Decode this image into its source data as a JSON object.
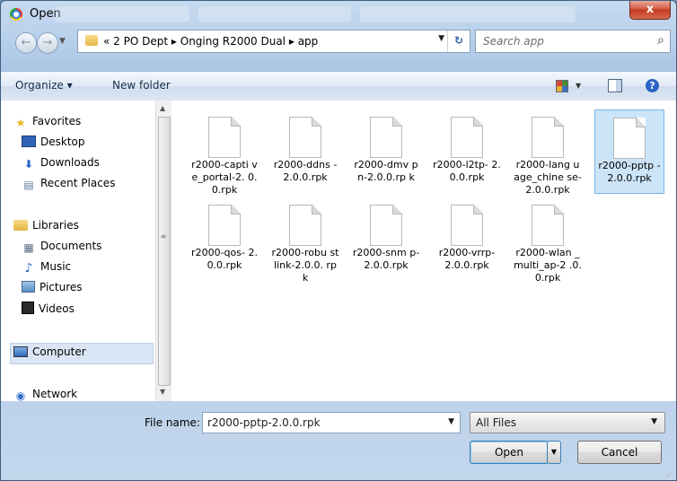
{
  "window": {
    "title": "Open",
    "close_glyph": "x"
  },
  "nav": {
    "back_glyph": "←",
    "forward_glyph": "→",
    "breadcrumb_prefix": "«",
    "breadcrumb": [
      "2 PO Dept",
      "Onging R2000 Dual",
      "app"
    ],
    "separator": "▸",
    "search_placeholder": "Search app"
  },
  "toolbar": {
    "organize_label": "Organize ▾",
    "new_folder_label": "New folder"
  },
  "sidebar": {
    "favorites": "Favorites",
    "desktop": "Desktop",
    "downloads": "Downloads",
    "recent": "Recent Places",
    "libraries": "Libraries",
    "documents": "Documents",
    "music": "Music",
    "pictures": "Pictures",
    "videos": "Videos",
    "computer": "Computer",
    "network": "Network"
  },
  "files": [
    {
      "name": "r2000-captive_portal-2.0.0.rpk",
      "display": "r2000-capti ve_portal-2. 0.0.rpk",
      "selected": false
    },
    {
      "name": "r2000-ddns-2.0.0.rpk",
      "display": "r2000-ddns -2.0.0.rpk",
      "selected": false
    },
    {
      "name": "r2000-dmvpn-2.0.0.rpk",
      "display": "r2000-dmv pn-2.0.0.rp k",
      "selected": false
    },
    {
      "name": "r2000-l2tp-2.0.0.rpk",
      "display": "r2000-l2tp- 2.0.0.rpk",
      "selected": false
    },
    {
      "name": "r2000-language_chinese-2.0.0.rpk",
      "display": "r2000-lang uage_chine se-2.0.0.rpk",
      "selected": false
    },
    {
      "name": "r2000-pptp-2.0.0.rpk",
      "display": "r2000-pptp -2.0.0.rpk",
      "selected": true
    },
    {
      "name": "r2000-qos-2.0.0.rpk",
      "display": "r2000-qos- 2.0.0.rpk",
      "selected": false
    },
    {
      "name": "r2000-robustlink-2.0.0.rpk",
      "display": "r2000-robu stlink-2.0.0. rpk",
      "selected": false
    },
    {
      "name": "r2000-snmp-2.0.0.rpk",
      "display": "r2000-snm p-2.0.0.rpk",
      "selected": false
    },
    {
      "name": "r2000-vrrp-2.0.0.rpk",
      "display": "r2000-vrrp- 2.0.0.rpk",
      "selected": false
    },
    {
      "name": "r2000-wlan_multi_ap-2.0.0.rpk",
      "display": "r2000-wlan _multi_ap-2 .0.0.rpk",
      "selected": false
    }
  ],
  "bottom": {
    "file_name_label": "File name:",
    "file_name_value": "r2000-pptp-2.0.0.rpk",
    "filter_value": "All Files",
    "open_label": "Open",
    "cancel_label": "Cancel"
  }
}
